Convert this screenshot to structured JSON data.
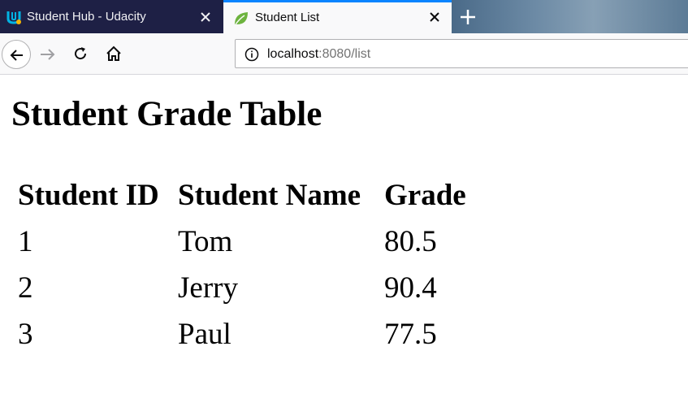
{
  "browser": {
    "tabs": [
      {
        "title": "Student Hub - Udacity",
        "icon": "udacity-logo-icon",
        "active": false
      },
      {
        "title": "Student List",
        "icon": "spring-leaf-icon",
        "active": true
      }
    ],
    "new_tab_icon": "plus-icon",
    "url": {
      "host": "localhost",
      "rest": ":8080/list"
    },
    "accent_color": "#0a84ff"
  },
  "page": {
    "title": "Student Grade Table",
    "table": {
      "headers": [
        "Student ID",
        "Student Name",
        "Grade"
      ],
      "rows": [
        [
          "1",
          "Tom",
          "80.5"
        ],
        [
          "2",
          "Jerry",
          "90.4"
        ],
        [
          "3",
          "Paul",
          "77.5"
        ]
      ]
    }
  }
}
